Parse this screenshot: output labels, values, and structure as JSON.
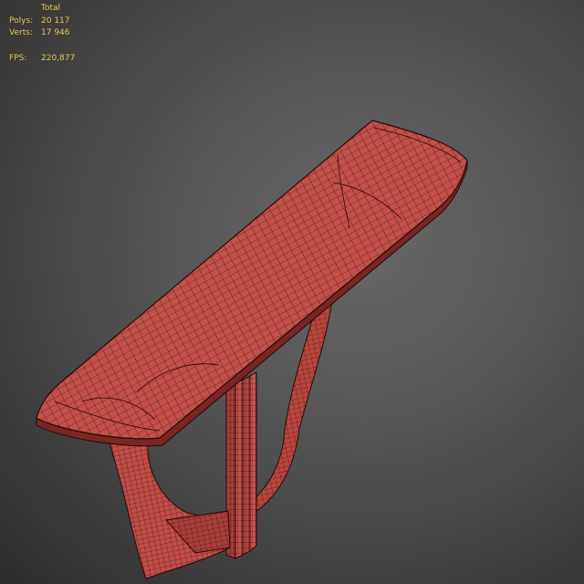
{
  "viewport": {
    "stats": {
      "header": "Total",
      "polys_label": "Polys:",
      "polys_value": "20 117",
      "verts_label": "Verts:",
      "verts_value": "17 946",
      "fps_label": "FPS:",
      "fps_value": "220,877"
    },
    "colors": {
      "stats_text": "#e6c74f",
      "mesh_fill": "#c4504a",
      "wire": "#2a0a08"
    },
    "model": "console table wireframe mesh"
  }
}
